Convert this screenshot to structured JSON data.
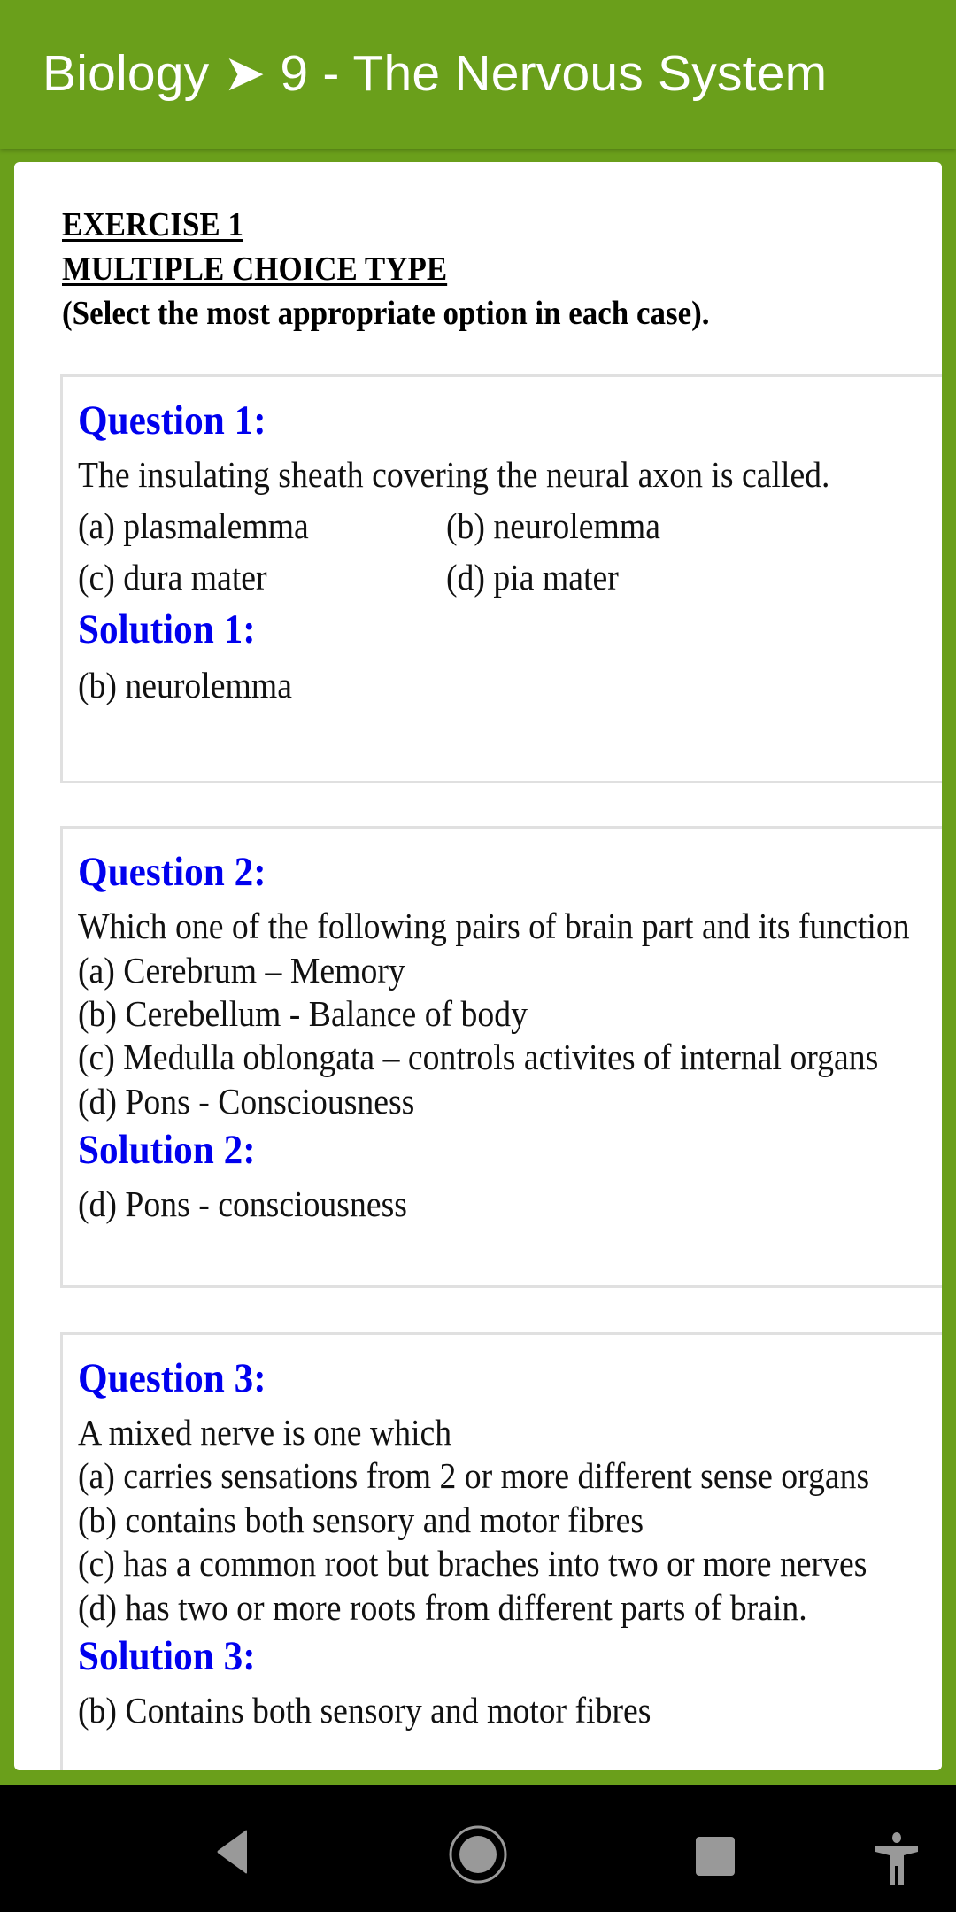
{
  "appbar": {
    "title": "Biology ➤ 9 - The Nervous System"
  },
  "exercise": {
    "title": "EXERCISE 1",
    "type": "MULTIPLE CHOICE TYPE",
    "instruction": "(Select the most appropriate option in each case)."
  },
  "questions": [
    {
      "heading": "Question 1:",
      "text": "The insulating sheath covering the neural axon is called.",
      "options": [
        "(a) plasmalemma",
        "(b) neurolemma",
        "(c) dura mater",
        "(d) pia mater"
      ],
      "solution_heading": "Solution 1:",
      "solution": "(b) neurolemma"
    },
    {
      "heading": "Question 2:",
      "text": "Which one of the following pairs of brain part and its function",
      "options": [
        " (a)  Cerebrum – Memory",
        " (b)  Cerebellum -  Balance of body",
        " (c)  Medulla oblongata – controls activites of internal organs",
        " (d)  Pons - Consciousness"
      ],
      "solution_heading": "Solution 2:",
      "solution": "(d) Pons - consciousness"
    },
    {
      "heading": "Question 3:",
      "text": "A mixed nerve is one which",
      "options": [
        "(a) carries sensations from 2 or more different sense organs",
        "(b) contains both sensory and motor fibres",
        "(c) has a common root but braches into two or more nerves",
        "(d) has two or more roots from different parts of brain."
      ],
      "solution_heading": "Solution 3:",
      "solution": "(b) Contains both sensory and motor fibres"
    }
  ],
  "navbar": {
    "buttons": [
      "back",
      "home",
      "recents",
      "accessibility"
    ]
  }
}
